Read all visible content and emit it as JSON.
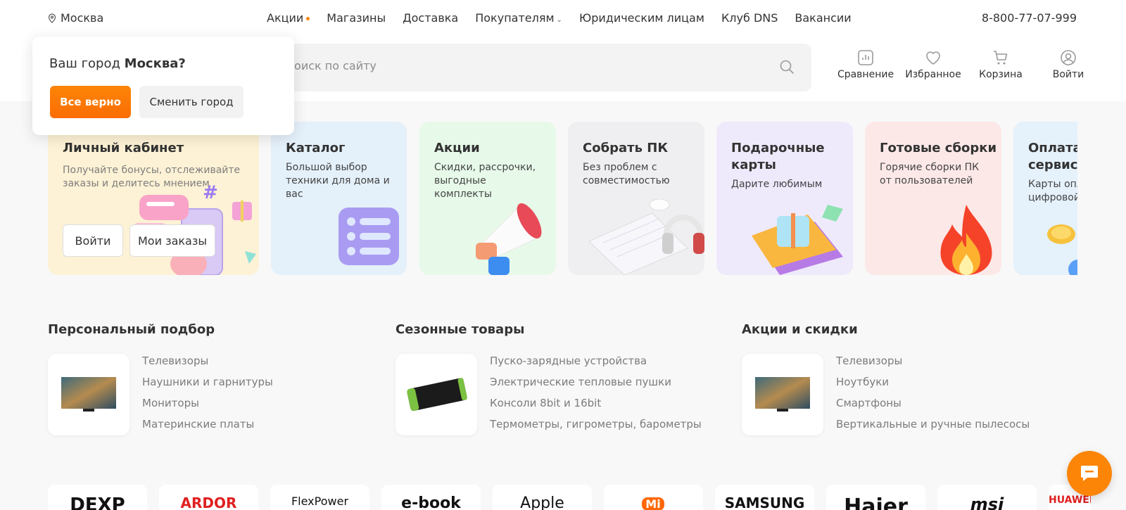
{
  "topbar": {
    "city": "Москва",
    "nav": [
      {
        "label": "Акции"
      },
      {
        "label": "Магазины"
      },
      {
        "label": "Доставка"
      },
      {
        "label": "Покупателям"
      },
      {
        "label": "Юридическим лицам"
      },
      {
        "label": "Клуб DNS"
      },
      {
        "label": "Вакансии"
      }
    ],
    "phone": "8-800-77-07-999"
  },
  "search": {
    "placeholder": "Поиск по сайту"
  },
  "header_icons": {
    "compare": "Сравнение",
    "favorites": "Избранное",
    "cart": "Корзина",
    "login": "Войти"
  },
  "city_popup": {
    "question_prefix": "Ваш город ",
    "city": "Москва?",
    "confirm": "Все верно",
    "change": "Сменить город"
  },
  "cards": {
    "account": {
      "title": "Личный кабинет",
      "subtitle": "Получайте бонусы, отслеживайте заказы и делитесь мнением",
      "login": "Войти",
      "orders": "Мои заказы"
    },
    "catalog": {
      "title": "Каталог",
      "subtitle": "Большой выбор техники для дома и вас"
    },
    "promo": {
      "title": "Акции",
      "subtitle": "Скидки, рассрочки, выгодные комплекты"
    },
    "build_pc": {
      "title": "Собрать ПК",
      "subtitle": "Без проблем с совместимостью"
    },
    "gift": {
      "title": "Подарочные карты",
      "subtitle": "Дарите любимым"
    },
    "ready": {
      "title": "Готовые сборки",
      "subtitle": "Горячие сборки ПК от пользователей"
    },
    "pay": {
      "title": "Оплата и сервисы",
      "subtitle": "Карты оплаты цифровой"
    }
  },
  "selections": [
    {
      "title": "Персональный подбор",
      "items": [
        "Телевизоры",
        "Наушники и гарнитуры",
        "Мониторы",
        "Материнские платы"
      ]
    },
    {
      "title": "Сезонные товары",
      "items": [
        "Пуско-зарядные устройства",
        "Электрические тепловые пушки",
        "Консоли 8bit и 16bit",
        "Термометры, гигрометры, барометры"
      ]
    },
    {
      "title": "Акции и скидки",
      "items": [
        "Телевизоры",
        "Ноутбуки",
        "Смартфоны",
        "Вертикальные и ручные пылесосы"
      ]
    }
  ],
  "brands": [
    "DEXP",
    "ARDOR",
    "FlexPower",
    "e-book",
    "Apple",
    "Mi",
    "SAMSUNG",
    "Haier",
    "msi",
    "HUAWEI"
  ],
  "colors": {
    "accent": "#fc8507"
  }
}
